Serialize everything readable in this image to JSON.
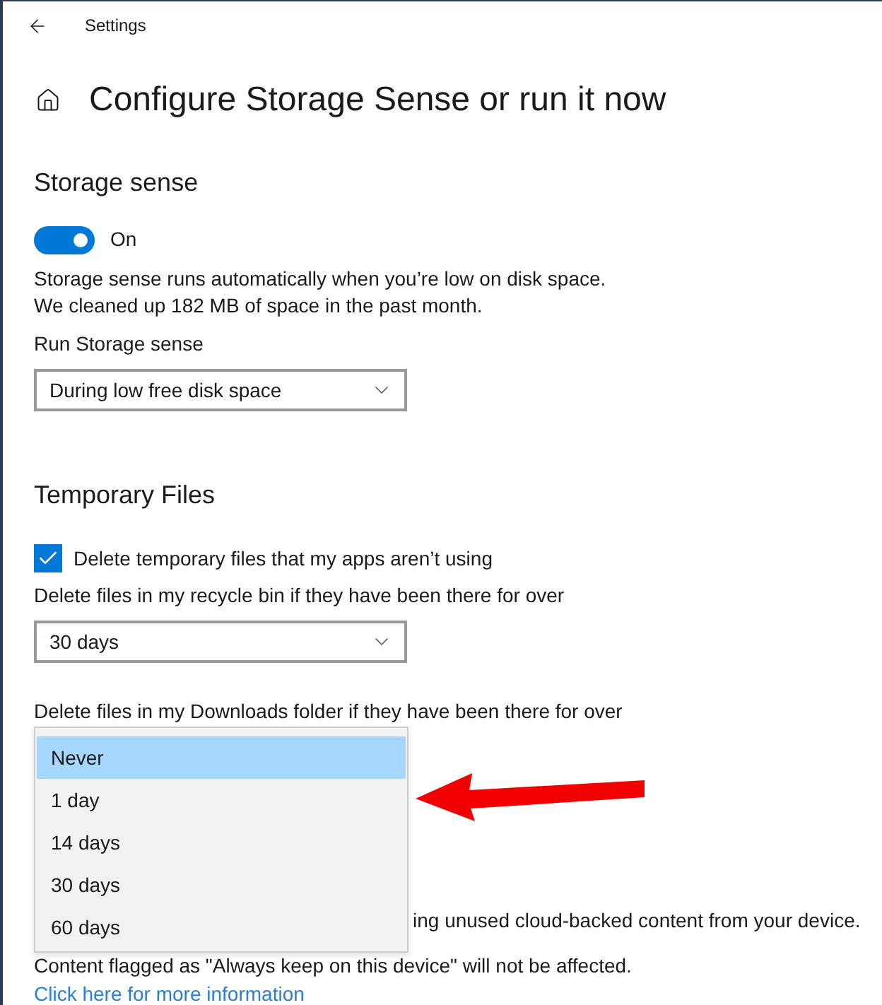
{
  "window": {
    "title": "Settings"
  },
  "page": {
    "title": "Configure Storage Sense or run it now"
  },
  "storage_sense": {
    "heading": "Storage sense",
    "toggle": {
      "on": true,
      "label": "On"
    },
    "description": [
      "Storage sense runs automatically when you’re low on disk space.",
      "We cleaned up 182 MB of space in the past month."
    ],
    "run_label": "Run Storage sense",
    "run_value": "During low free disk space"
  },
  "temporary_files": {
    "heading": "Temporary Files",
    "delete_temp": {
      "label": "Delete temporary files that my apps aren’t using",
      "checked": true
    },
    "recycle_bin": {
      "label": "Delete files in my recycle bin if they have been there for over",
      "value": "30 days"
    },
    "downloads": {
      "label": "Delete files in my Downloads folder if they have been there for over",
      "options": [
        {
          "label": "Never",
          "selected": true
        },
        {
          "label": "1 day",
          "selected": false
        },
        {
          "label": "14 days",
          "selected": false
        },
        {
          "label": "30 days",
          "selected": false
        },
        {
          "label": "60 days",
          "selected": false
        }
      ]
    }
  },
  "cloud_content": {
    "lines": [
      "ing unused cloud-backed content from your device.",
      "Content flagged as \"Always keep on this device\" will not be affected."
    ],
    "link": "Click here for more information"
  }
}
